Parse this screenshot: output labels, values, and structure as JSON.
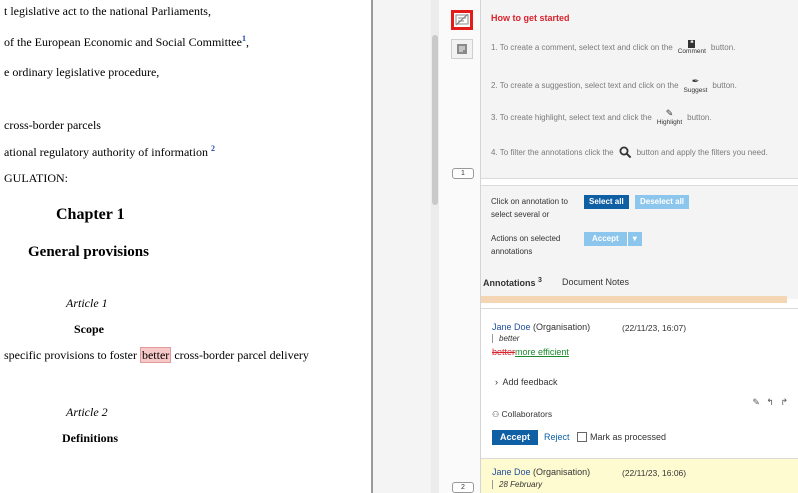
{
  "document": {
    "lines": [
      {
        "before": "t legislative act to the national Parliaments,",
        "hl": "",
        "after": "",
        "sup": ""
      },
      {
        "before": "of the European Economic and Social Committee",
        "hl": "",
        "after": "",
        "sup": "1"
      },
      {
        "before": "e ordinary legislative procedure,",
        "hl": "",
        "after": "",
        "sup": ""
      },
      {
        "before": "cross-border parcels",
        "hl": "",
        "after": "",
        "sup": ""
      },
      {
        "before": "ational regulatory authority of information ",
        "hl": "",
        "after": "",
        "sup": "2"
      },
      {
        "before": "GULATION:",
        "hl": "",
        "after": "",
        "sup": ""
      }
    ],
    "chapter": "Chapter 1",
    "chapter_title": "General provisions",
    "article1": "Article 1",
    "article1_title": "Scope",
    "scope_text": {
      "before": " specific provisions to foster ",
      "hl": "better",
      "after": " cross-border parcel delivery"
    },
    "article2": "Article 2",
    "article2_title": "Definitions"
  },
  "gutter_markers": [
    "1",
    "2"
  ],
  "getting_started": {
    "title": "How to get started",
    "steps": [
      {
        "before": "1. To create a comment, select text and click on the",
        "icon": "comment-icon",
        "icon_label": "Comment",
        "after": "button."
      },
      {
        "before": "2. To create a suggestion, select text and click on the",
        "icon": "suggest-icon",
        "icon_label": "Suggest",
        "after": "button."
      },
      {
        "before": "3. To create highlight, select text and click the",
        "icon": "highlight-icon",
        "icon_label": "Highlight",
        "after": "button."
      },
      {
        "before": "4. To filter the annotations click the",
        "icon": "search-icon",
        "icon_label": "",
        "after": "button and apply the filters you need."
      }
    ]
  },
  "selection": {
    "click_text_1": "Click on annotation to",
    "click_text_2": "select several or",
    "select_all": "Select all",
    "deselect_all": "Deselect all",
    "actions_text_1": "Actions on selected",
    "actions_text_2": "annotations",
    "accept_dropdown": "Accept",
    "dropdown_caret": "▾"
  },
  "tabs": {
    "annotations_label": "Annotations",
    "annotations_count": "3",
    "notes_label": "Document Notes"
  },
  "annotations": [
    {
      "author": "Jane Doe",
      "org": "(Organisation)",
      "date": "(22/11/23, 16:07)",
      "quote": "better",
      "deleted": "better",
      "inserted": "more efficient",
      "feedback": "Add feedback",
      "collaborators": "Collaborators",
      "action_icons": "✎ ↰ ↱",
      "accept": "Accept",
      "reject": "Reject",
      "mark": "Mark as processed"
    },
    {
      "author": "Jane Doe",
      "org": "(Organisation)",
      "date": "(22/11/23, 16:06)",
      "quote": "28 February"
    }
  ],
  "icons": {
    "toolbar_active": "hide-annotations-icon",
    "toolbar_second": "notes-icon",
    "feedback_chevron": "chevron-right-icon",
    "collaborators": "people-icon"
  },
  "colors": {
    "accent_red": "#d9232d",
    "primary_blue": "#0f5fa5",
    "light_blue": "#8dc6ec",
    "highlight_pink": "#f7c8c8",
    "highlight_yellow": "#fffbd1",
    "insert_green": "#1d8a2d"
  }
}
